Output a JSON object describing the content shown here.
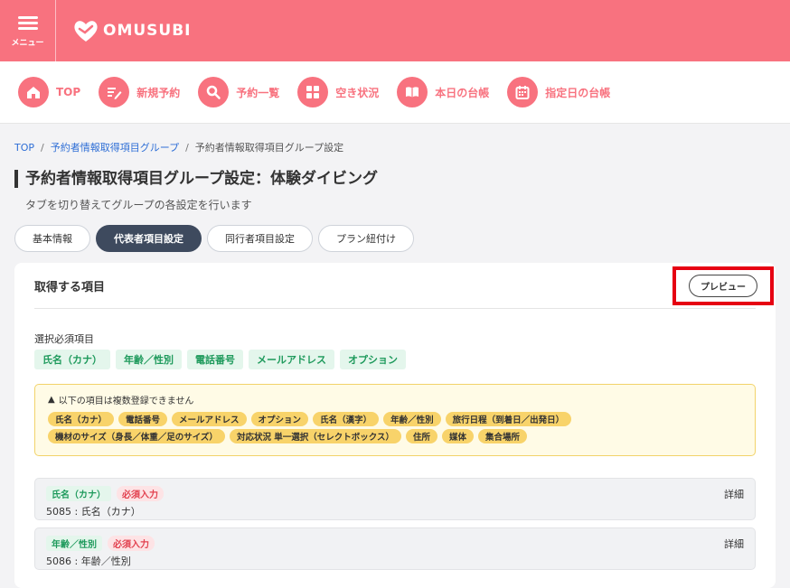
{
  "header": {
    "menu_label": "メニュー",
    "brand": "OMUSUBI"
  },
  "nav": [
    {
      "label": "TOP",
      "icon": "home-icon"
    },
    {
      "label": "新規予約",
      "icon": "edit-icon"
    },
    {
      "label": "予約一覧",
      "icon": "search-icon"
    },
    {
      "label": "空き状況",
      "icon": "grid-icon"
    },
    {
      "label": "本日の台帳",
      "icon": "book-icon"
    },
    {
      "label": "指定日の台帳",
      "icon": "calendar-icon"
    }
  ],
  "breadcrumb": {
    "top": "TOP",
    "group": "予約者情報取得項目グループ",
    "current": "予約者情報取得項目グループ設定"
  },
  "page": {
    "title": "予約者情報取得項目グループ設定：体験ダイビング",
    "subtitle": "タブを切り替えてグループの各設定を行います"
  },
  "tabs": [
    {
      "label": "基本情報",
      "active": false
    },
    {
      "label": "代表者項目設定",
      "active": true
    },
    {
      "label": "同行者項目設定",
      "active": false
    },
    {
      "label": "プラン紐付け",
      "active": false
    }
  ],
  "panel": {
    "title": "取得する項目",
    "preview_label": "プレビュー",
    "required_label": "選択必須項目",
    "required_chips": [
      "氏名（カナ）",
      "年齢／性別",
      "電話番号",
      "メールアドレス",
      "オプション"
    ],
    "warning": {
      "text": "以下の項目は複数登録できません",
      "chips": [
        "氏名（カナ）",
        "電話番号",
        "メールアドレス",
        "オプション",
        "氏名（漢字）",
        "年齢／性別",
        "旅行日程（到着日／出発日）",
        "機材のサイズ（身長／体重／足のサイズ）",
        "対応状況 単一選択（セレクトボックス）",
        "住所",
        "媒体",
        "集合場所"
      ]
    },
    "items": [
      {
        "tag": "氏名（カナ）",
        "badge": "必須入力",
        "text": "5085 : 氏名（カナ）",
        "detail": "詳細"
      },
      {
        "tag": "年齢／性別",
        "badge": "必須入力",
        "text": "5086 : 年齢／性別",
        "detail": "詳細"
      }
    ]
  },
  "colors": {
    "brand": "#f8727f",
    "active_tab": "#3e4a5e",
    "highlight": "#e60012"
  }
}
